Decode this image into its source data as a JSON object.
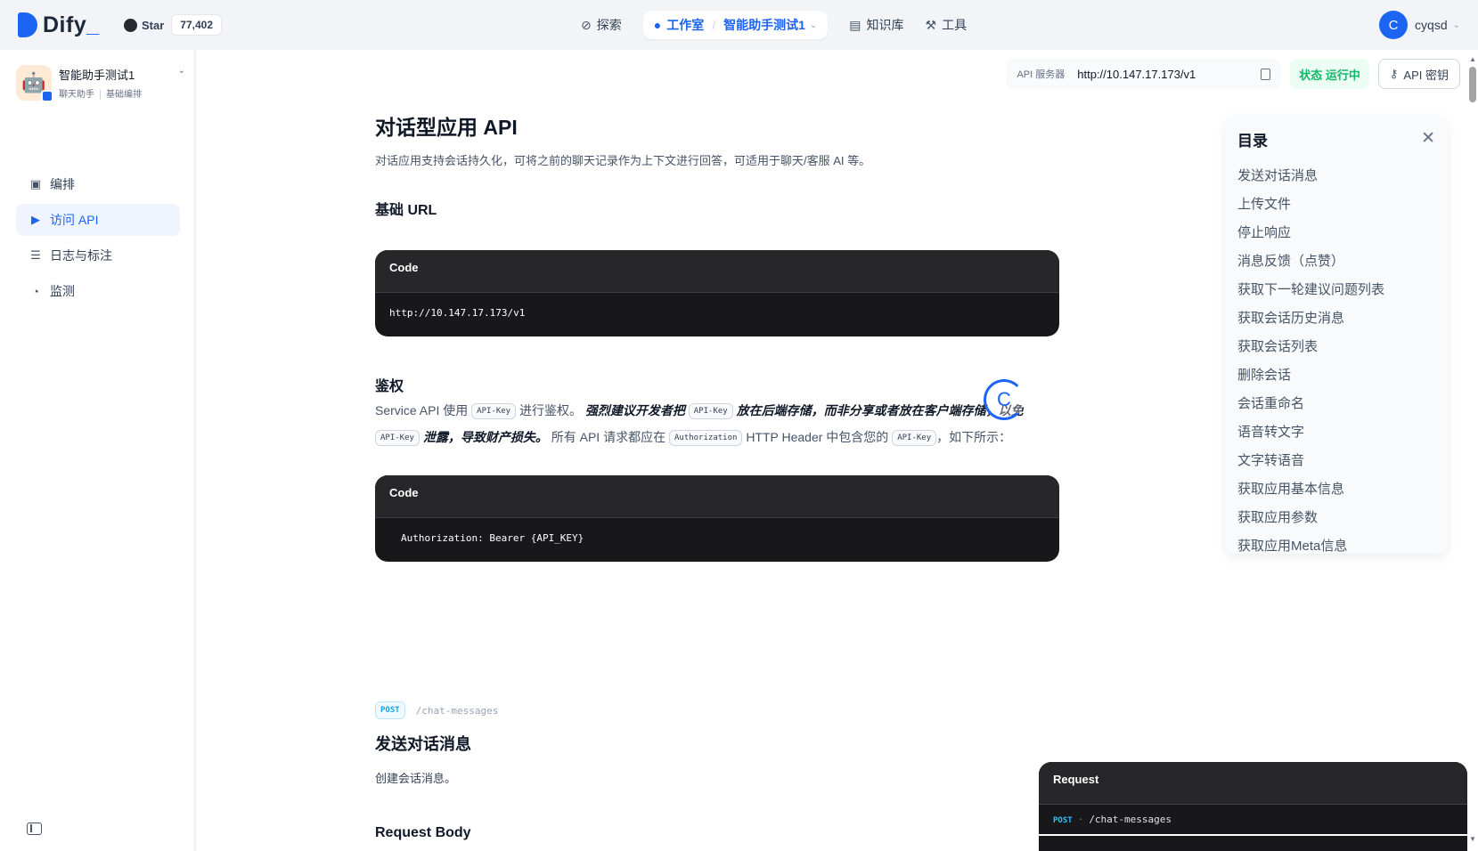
{
  "brand": {
    "name": "Dify",
    "suffix": "_"
  },
  "github": {
    "label": "Star",
    "count": "77,402"
  },
  "nav": {
    "explore": "探索",
    "studio": "工作室",
    "current_app": "智能助手测试1",
    "knowledge": "知识库",
    "tools": "工具"
  },
  "user": {
    "initial": "C",
    "name": "cyqsd"
  },
  "app": {
    "name": "智能助手测试1",
    "tags": [
      "聊天助手",
      "基础编排"
    ],
    "icon": "robot-emoji"
  },
  "sidebar": {
    "items": [
      {
        "label": "编排",
        "icon": "layout-icon"
      },
      {
        "label": "访问 API",
        "icon": "terminal-icon",
        "active": true
      },
      {
        "label": "日志与标注",
        "icon": "file-list-icon"
      },
      {
        "label": "监测",
        "icon": "dashboard-icon"
      }
    ]
  },
  "api_bar": {
    "server_label": "API 服务器",
    "server_url": "http://10.147.17.173/v1",
    "status": "状态 运行中",
    "api_key_button": "API 密钥"
  },
  "doc": {
    "title": "对话型应用 API",
    "description": "对话应用支持会话持久化，可将之前的聊天记录作为上下文进行回答，可适用于聊天/客服 AI 等。",
    "base_url_heading": "基础 URL",
    "code_label": "Code",
    "base_url_code": "http://10.147.17.173/v1",
    "auth_heading": "鉴权",
    "auth_p1": "Service API 使用",
    "auth_code_1": "API-Key",
    "auth_p2": "进行鉴权。",
    "auth_warn_1": "强烈建议开发者把",
    "auth_code_2": "API-Key",
    "auth_warn_2": "放在后端存储，而非分享或者放在客户端存储，以免",
    "auth_code_3": "API-Key",
    "auth_warn_3": "泄露，导致财产损失。",
    "auth_p3": "所有 API 请求都应在",
    "auth_code_4": "Authorization",
    "auth_p4": "HTTP Header 中包含您的",
    "auth_code_5": "API-Key",
    "auth_p5": "，如下所示：",
    "auth_code_sample": "Authorization: Bearer {API_KEY}",
    "endpoint_method": "POST",
    "endpoint_path": "/chat-messages",
    "send_title": "发送对话消息",
    "send_desc": "创建会话消息。",
    "request_body_heading": "Request Body",
    "request_panel_title": "Request",
    "request_method": "POST",
    "request_path": "/chat-messages"
  },
  "loader": {
    "glyph": "C"
  },
  "toc": {
    "title": "目录",
    "items": [
      "发送对话消息",
      "上传文件",
      "停止响应",
      "消息反馈（点赞）",
      "获取下一轮建议问题列表",
      "获取会话历史消息",
      "获取会话列表",
      "删除会话",
      "会话重命名",
      "语音转文字",
      "文字转语音",
      "获取应用基本信息",
      "获取应用参数",
      "获取应用Meta信息"
    ]
  },
  "colors": {
    "accent": "#1c64f2",
    "status_green": "#12b76a",
    "code_bg": "#18181b"
  }
}
